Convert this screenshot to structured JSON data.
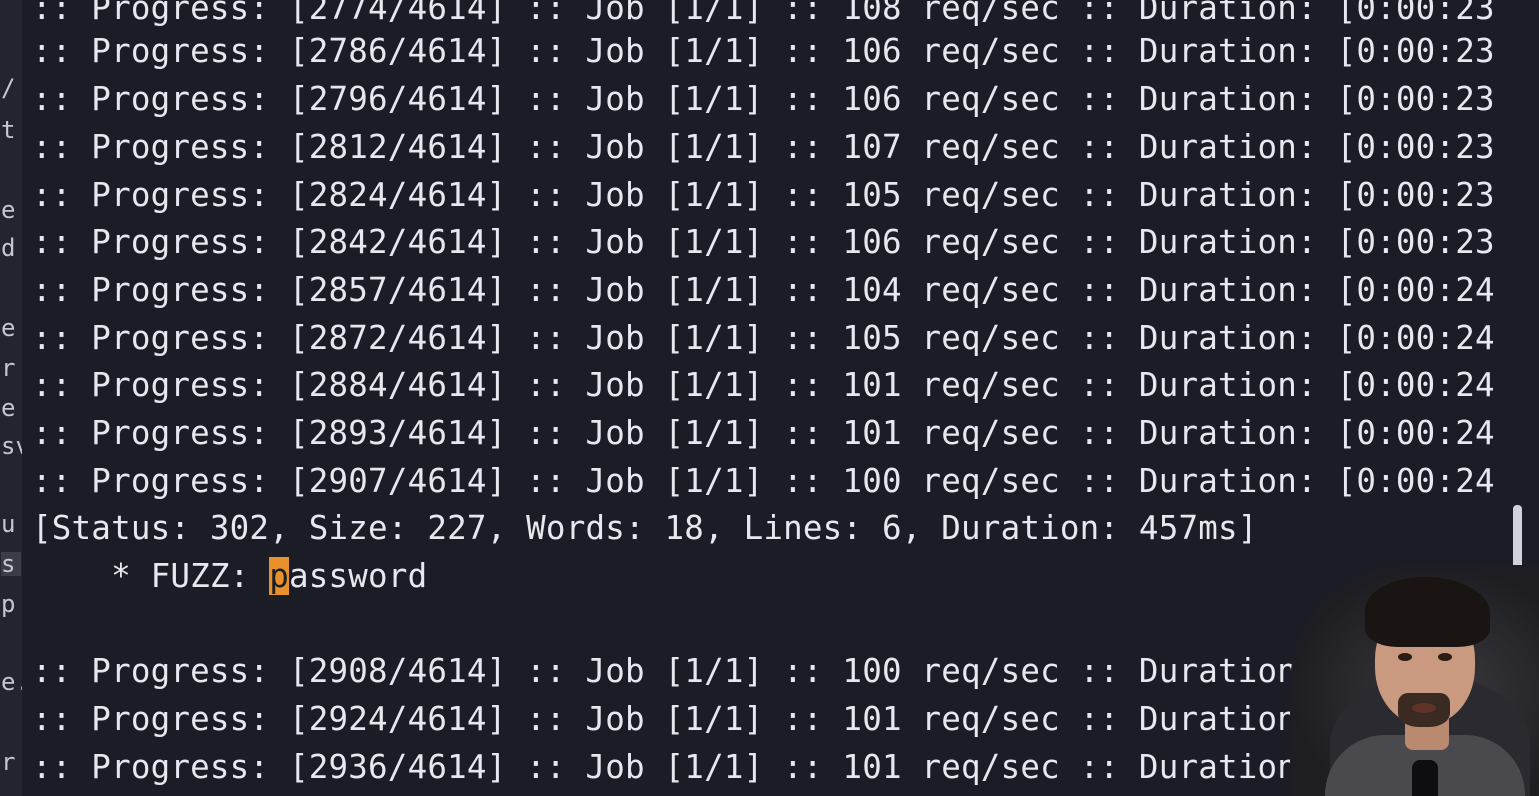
{
  "terminal": {
    "progress_lines_top": [
      ":: Progress: [2774/4614] :: Job [1/1] :: 108 req/sec :: Duration: [0:00:23",
      ":: Progress: [2786/4614] :: Job [1/1] :: 106 req/sec :: Duration: [0:00:23",
      ":: Progress: [2796/4614] :: Job [1/1] :: 106 req/sec :: Duration: [0:00:23",
      ":: Progress: [2812/4614] :: Job [1/1] :: 107 req/sec :: Duration: [0:00:23",
      ":: Progress: [2824/4614] :: Job [1/1] :: 105 req/sec :: Duration: [0:00:23",
      ":: Progress: [2842/4614] :: Job [1/1] :: 106 req/sec :: Duration: [0:00:23",
      ":: Progress: [2857/4614] :: Job [1/1] :: 104 req/sec :: Duration: [0:00:24",
      ":: Progress: [2872/4614] :: Job [1/1] :: 105 req/sec :: Duration: [0:00:24",
      ":: Progress: [2884/4614] :: Job [1/1] :: 101 req/sec :: Duration: [0:00:24",
      ":: Progress: [2893/4614] :: Job [1/1] :: 101 req/sec :: Duration: [0:00:24",
      ":: Progress: [2907/4614] :: Job [1/1] :: 100 req/sec :: Duration: [0:00:24"
    ],
    "result_line": "[Status: 302, Size: 227, Words: 18, Lines: 6, Duration: 457ms]",
    "fuzz_prefix": "    * FUZZ: ",
    "fuzz_cursor_char": "p",
    "fuzz_rest": "assword",
    "progress_lines_bottom": [
      ":: Progress: [2908/4614] :: Job [1/1] :: 100 req/sec :: Duration: [",
      ":: Progress: [2924/4614] :: Job [1/1] :: 101 req/sec :: Duration: [",
      ":: Progress: [2936/4614] :: Job [1/1] :: 101 req/sec :: Duration:"
    ]
  },
  "left_strip": {
    "chars": [
      "/",
      "t",
      "e",
      "d",
      "e",
      "r",
      "e",
      "sv",
      "u",
      "s",
      "p",
      "e.",
      "r"
    ]
  },
  "colors": {
    "background": "#1b1d26",
    "text": "#e6e8ee",
    "cursor": "#e8902c"
  }
}
